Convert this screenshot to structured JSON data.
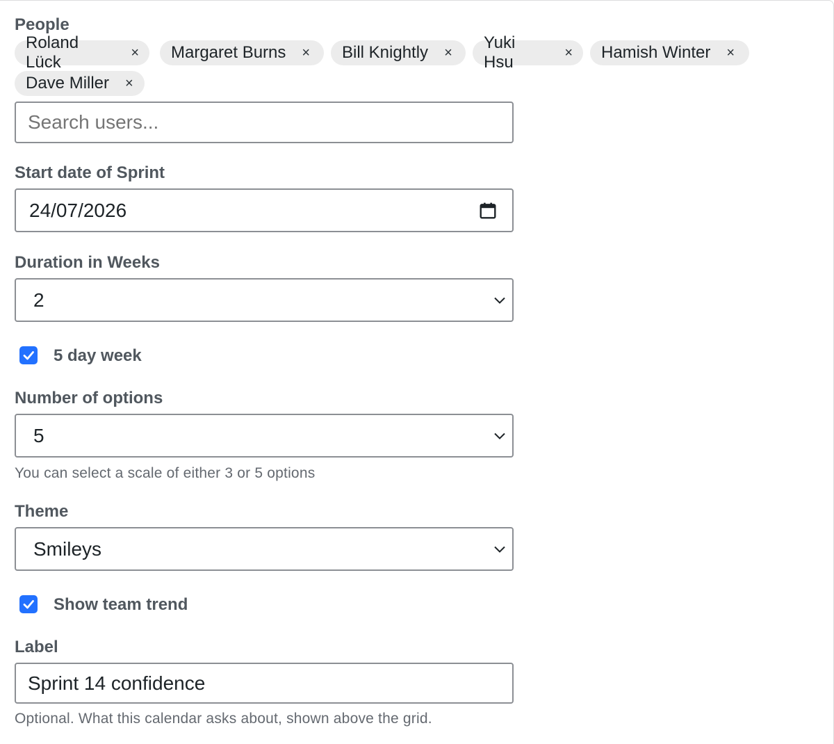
{
  "people": {
    "label": "People",
    "chips": [
      {
        "name": "Roland Lück"
      },
      {
        "name": "Margaret Burns"
      },
      {
        "name": "Bill Knightly"
      },
      {
        "name": "Yuki Hsu"
      },
      {
        "name": "Hamish Winter"
      },
      {
        "name": "Dave Miller"
      }
    ],
    "remove_glyph": "×",
    "search_placeholder": "Search users..."
  },
  "start_date": {
    "label": "Start date of Sprint",
    "value": "24/07/2026",
    "icon": "calendar-icon"
  },
  "duration": {
    "label": "Duration in Weeks",
    "value": "2",
    "icon": "chevron-down-icon"
  },
  "five_day_week": {
    "label": "5 day week",
    "checked": true
  },
  "num_options": {
    "label": "Number of options",
    "value": "5",
    "help": "You can select a scale of either 3 or 5 options"
  },
  "theme": {
    "label": "Theme",
    "value": "Smileys"
  },
  "show_team_trend": {
    "label": "Show team trend",
    "checked": true
  },
  "label_field": {
    "label": "Label",
    "value": "Sprint 14 confidence",
    "help": "Optional. What this calendar asks about, shown above the grid."
  },
  "colors": {
    "accent": "#2271ff",
    "chip_bg": "#ececec",
    "border": "#8c8f94",
    "label_text": "#50575e"
  }
}
